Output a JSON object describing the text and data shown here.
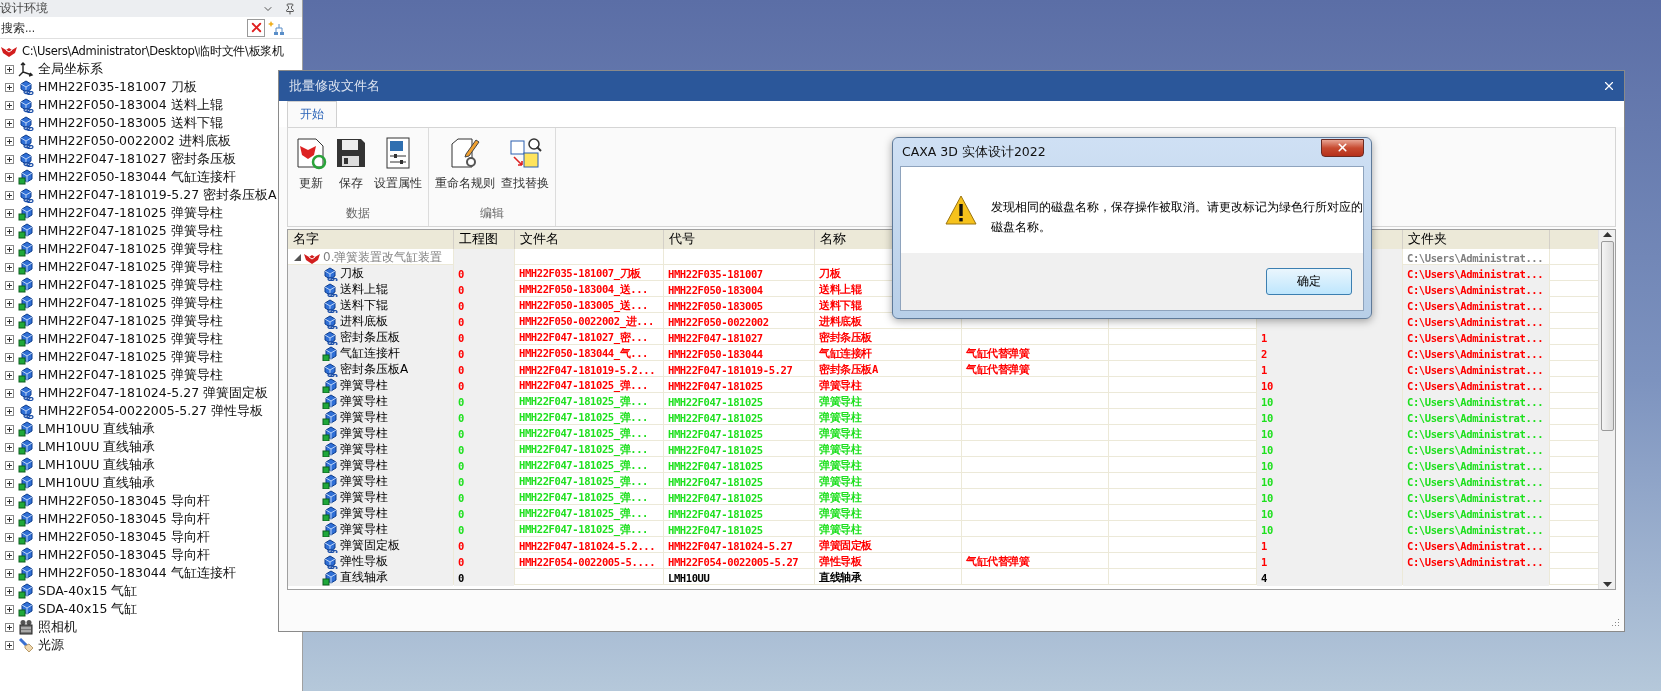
{
  "design_panel": {
    "title": "设计环境",
    "search": {
      "placeholder": "搜索..."
    },
    "tree": {
      "label": "C:\\Users\\Administrator\\Desktop\\临时文件\\板浆机",
      "kind": "assembly",
      "children": [
        {
          "label": "全局坐标系",
          "kind": "axes",
          "expanded": false
        },
        {
          "label": "HMH22F035-181007 刀板",
          "kind": "linked",
          "expanded": false
        },
        {
          "label": "HMH22F050-183004 送料上辊",
          "kind": "linked",
          "expanded": false
        },
        {
          "label": "HMH22F050-183005 送料下辊",
          "kind": "linked",
          "expanded": false
        },
        {
          "label": "HMH22F050-0022002 进料底板",
          "kind": "linked",
          "expanded": false
        },
        {
          "label": "HMH22F047-181027 密封条压板",
          "kind": "linked",
          "expanded": false
        },
        {
          "label": "HMH22F050-183044 气缸连接杆",
          "kind": "part",
          "expanded": false
        },
        {
          "label": "HMH22F047-181019-5.27 密封条压板A",
          "kind": "linked",
          "expanded": false
        },
        {
          "label": "HMH22F047-181025 弹簧导柱",
          "kind": "part",
          "expanded": false
        },
        {
          "label": "HMH22F047-181025 弹簧导柱",
          "kind": "part",
          "expanded": false
        },
        {
          "label": "HMH22F047-181025 弹簧导柱",
          "kind": "part",
          "expanded": false
        },
        {
          "label": "HMH22F047-181025 弹簧导柱",
          "kind": "part",
          "expanded": false
        },
        {
          "label": "HMH22F047-181025 弹簧导柱",
          "kind": "part",
          "expanded": false
        },
        {
          "label": "HMH22F047-181025 弹簧导柱",
          "kind": "part",
          "expanded": false
        },
        {
          "label": "HMH22F047-181025 弹簧导柱",
          "kind": "part",
          "expanded": false
        },
        {
          "label": "HMH22F047-181025 弹簧导柱",
          "kind": "part",
          "expanded": false
        },
        {
          "label": "HMH22F047-181025 弹簧导柱",
          "kind": "part",
          "expanded": false
        },
        {
          "label": "HMH22F047-181025 弹簧导柱",
          "kind": "part",
          "expanded": false
        },
        {
          "label": "HMH22F047-181024-5.27 弹簧固定板",
          "kind": "linked",
          "expanded": false
        },
        {
          "label": "HMH22F054-0022005-5.27 弹性导板",
          "kind": "linked",
          "expanded": false
        },
        {
          "label": "LMH10UU 直线轴承",
          "kind": "part",
          "expanded": false
        },
        {
          "label": "LMH10UU 直线轴承",
          "kind": "part",
          "expanded": false
        },
        {
          "label": "LMH10UU 直线轴承",
          "kind": "part",
          "expanded": false
        },
        {
          "label": "LMH10UU 直线轴承",
          "kind": "part",
          "expanded": false
        },
        {
          "label": "HMH22F050-183045 导向杆",
          "kind": "part",
          "expanded": false
        },
        {
          "label": "HMH22F050-183045 导向杆",
          "kind": "part",
          "expanded": false
        },
        {
          "label": "HMH22F050-183045 导向杆",
          "kind": "part",
          "expanded": false
        },
        {
          "label": "HMH22F050-183045 导向杆",
          "kind": "part",
          "expanded": false
        },
        {
          "label": "HMH22F050-183044 气缸连接杆",
          "kind": "part",
          "expanded": false
        },
        {
          "label": "SDA-40x15 气缸",
          "kind": "part",
          "expanded": false
        },
        {
          "label": "SDA-40x15 气缸",
          "kind": "part",
          "expanded": false
        },
        {
          "label": "照相机",
          "kind": "camera",
          "expanded": false
        },
        {
          "label": "光源",
          "kind": "light",
          "expanded": false
        }
      ]
    }
  },
  "dialog": {
    "title": "批量修改文件名",
    "tabs": [
      {
        "label": "开始",
        "selected": true
      }
    ],
    "groups": [
      {
        "label": "数据",
        "buttons": [
          {
            "label": "更新",
            "kind": "update"
          },
          {
            "label": "保存",
            "kind": "save"
          },
          {
            "label": "设置属性",
            "kind": "properties"
          }
        ]
      },
      {
        "label": "编辑",
        "buttons": [
          {
            "label": "重命名规则",
            "kind": "rename"
          },
          {
            "label": "查找替换",
            "kind": "find"
          }
        ]
      }
    ],
    "table": {
      "columns": [
        {
          "label": "名字"
        },
        {
          "label": "工程图"
        },
        {
          "label": "文件名"
        },
        {
          "label": "代号"
        },
        {
          "label": "名称"
        },
        {},
        {},
        {},
        {
          "label": "文件夹"
        }
      ],
      "rows": [
        {
          "name": "0.弹簧装置改气缸装置",
          "kind": "assembly",
          "expanded": true,
          "color": "#808080",
          "folder": "C:\\Users\\Administrat...",
          "children": [
            {
              "name": "刀板",
              "kind": "linked",
              "color": "#ff0000",
              "drawing": "0",
              "file_name": "HMH22F035-181007_刀板",
              "code": "HMH22F035-181007",
              "title": "刀板",
              "folder": "C:\\Users\\Administrat..."
            },
            {
              "name": "送料上辊",
              "kind": "linked",
              "color": "#ff0000",
              "drawing": "0",
              "file_name": "HMH22F050-183004_送...",
              "code": "HMH22F050-183004",
              "title": "送料上辊",
              "folder": "C:\\Users\\Administrat..."
            },
            {
              "name": "送料下辊",
              "kind": "linked",
              "color": "#ff0000",
              "drawing": "0",
              "file_name": "HMH22F050-183005_送...",
              "code": "HMH22F050-183005",
              "title": "送料下辊",
              "folder": "C:\\Users\\Administrat..."
            },
            {
              "name": "进料底板",
              "kind": "linked",
              "color": "#ff0000",
              "drawing": "0",
              "file_name": "HMH22F050-0022002_进...",
              "code": "HMH22F050-0022002",
              "title": "进料底板",
              "folder": "C:\\Users\\Administrat..."
            },
            {
              "name": "密封条压板",
              "kind": "linked",
              "color": "#ff0000",
              "drawing": "0",
              "file_name": "HMH22F047-181027_密...",
              "code": "HMH22F047-181027",
              "title": "密封条压板",
              "column_8": "1",
              "folder": "C:\\Users\\Administrat..."
            },
            {
              "name": "气缸连接杆",
              "kind": "part",
              "color": "#ff0000",
              "drawing": "0",
              "file_name": "HMH22F050-183044_气...",
              "code": "HMH22F050-183044",
              "title": "气缸连接杆",
              "column_6": "气缸代替弹簧",
              "column_8": "2",
              "folder": "C:\\Users\\Administrat..."
            },
            {
              "name": "密封条压板A",
              "kind": "linked",
              "color": "#ff0000",
              "drawing": "0",
              "file_name": "HMH22F047-181019-5.2...",
              "code": "HMH22F047-181019-5.27",
              "title": "密封条压板A",
              "column_6": "气缸代替弹簧",
              "column_8": "1",
              "folder": "C:\\Users\\Administrat..."
            },
            {
              "name": "弹簧导柱",
              "kind": "part",
              "color": "#ff0000",
              "drawing": "0",
              "file_name": "HMH22F047-181025_弹...",
              "code": "HMH22F047-181025",
              "title": "弹簧导柱",
              "column_8": "10",
              "folder": "C:\\Users\\Administrat..."
            },
            {
              "name": "弹簧导柱",
              "kind": "part",
              "color": "#1ee01e",
              "drawing": "0",
              "file_name": "HMH22F047-181025_弹...",
              "code": "HMH22F047-181025",
              "title": "弹簧导柱",
              "column_8": "10",
              "folder": "C:\\Users\\Administrat..."
            },
            {
              "name": "弹簧导柱",
              "kind": "part",
              "color": "#1ee01e",
              "drawing": "0",
              "file_name": "HMH22F047-181025_弹...",
              "code": "HMH22F047-181025",
              "title": "弹簧导柱",
              "column_8": "10",
              "folder": "C:\\Users\\Administrat..."
            },
            {
              "name": "弹簧导柱",
              "kind": "part",
              "color": "#1ee01e",
              "drawing": "0",
              "file_name": "HMH22F047-181025_弹...",
              "code": "HMH22F047-181025",
              "title": "弹簧导柱",
              "column_8": "10",
              "folder": "C:\\Users\\Administrat..."
            },
            {
              "name": "弹簧导柱",
              "kind": "part",
              "color": "#1ee01e",
              "drawing": "0",
              "file_name": "HMH22F047-181025_弹...",
              "code": "HMH22F047-181025",
              "title": "弹簧导柱",
              "column_8": "10",
              "folder": "C:\\Users\\Administrat..."
            },
            {
              "name": "弹簧导柱",
              "kind": "part",
              "color": "#1ee01e",
              "drawing": "0",
              "file_name": "HMH22F047-181025_弹...",
              "code": "HMH22F047-181025",
              "title": "弹簧导柱",
              "column_8": "10",
              "folder": "C:\\Users\\Administrat..."
            },
            {
              "name": "弹簧导柱",
              "kind": "part",
              "color": "#1ee01e",
              "drawing": "0",
              "file_name": "HMH22F047-181025_弹...",
              "code": "HMH22F047-181025",
              "title": "弹簧导柱",
              "column_8": "10",
              "folder": "C:\\Users\\Administrat..."
            },
            {
              "name": "弹簧导柱",
              "kind": "part",
              "color": "#1ee01e",
              "drawing": "0",
              "file_name": "HMH22F047-181025_弹...",
              "code": "HMH22F047-181025",
              "title": "弹簧导柱",
              "column_8": "10",
              "folder": "C:\\Users\\Administrat..."
            },
            {
              "name": "弹簧导柱",
              "kind": "part",
              "color": "#1ee01e",
              "drawing": "0",
              "file_name": "HMH22F047-181025_弹...",
              "code": "HMH22F047-181025",
              "title": "弹簧导柱",
              "column_8": "10",
              "folder": "C:\\Users\\Administrat..."
            },
            {
              "name": "弹簧导柱",
              "kind": "part",
              "color": "#1ee01e",
              "drawing": "0",
              "file_name": "HMH22F047-181025_弹...",
              "code": "HMH22F047-181025",
              "title": "弹簧导柱",
              "column_8": "10",
              "folder": "C:\\Users\\Administrat..."
            },
            {
              "name": "弹簧固定板",
              "kind": "linked",
              "color": "#ff0000",
              "drawing": "0",
              "file_name": "HMH22F047-181024-5.2...",
              "code": "HMH22F047-181024-5.27",
              "title": "弹簧固定板",
              "column_8": "1",
              "folder": "C:\\Users\\Administrat..."
            },
            {
              "name": "弹性导板",
              "kind": "linked",
              "color": "#ff0000",
              "drawing": "0",
              "file_name": "HMH22F054-0022005-5....",
              "code": "HMH22F054-0022005-5.27",
              "title": "弹性导板",
              "column_6": "气缸代替弹簧",
              "column_8": "1",
              "folder": "C:\\Users\\Administrat..."
            },
            {
              "name": "直线轴承",
              "kind": "part",
              "color": "#000000",
              "drawing": "0",
              "code": "LMH10UU",
              "title": "直线轴承",
              "column_8": "4"
            }
          ]
        }
      ]
    },
    "message_box": {
      "title": "CAXA 3D 实体设计2022",
      "message": "发现相同的磁盘名称，保存操作被取消。请更改标记为绿色行所对应的磁盘名称。",
      "buttons": [
        "确定"
      ]
    }
  }
}
